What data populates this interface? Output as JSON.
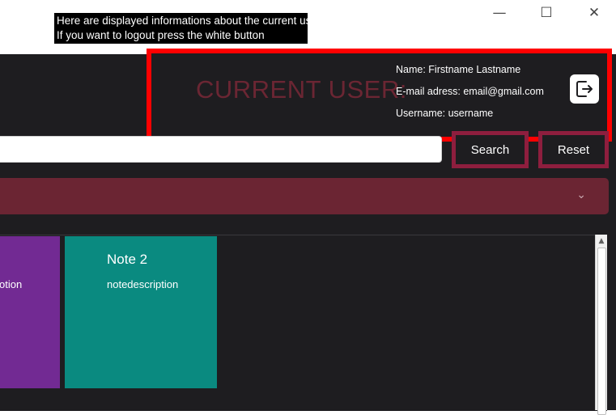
{
  "tooltip": {
    "line1": "Here are displayed informations about the current user",
    "line2": "If you want to logout press the white button"
  },
  "window_controls": {
    "minimize": "—",
    "maximize": "☐",
    "close": "✕"
  },
  "user_panel": {
    "title": "CURRENT USER:",
    "name": "Name: Firstname Lastname",
    "email": "E-mail adress: email@gmail.com",
    "username": "Username: username",
    "logout_icon": "logout-icon"
  },
  "search": {
    "value": "",
    "search_label": "Search",
    "reset_label": "Reset"
  },
  "dropdown": {
    "value": "",
    "chevron": "⌄"
  },
  "notes": [
    {
      "title": "",
      "description": "otion",
      "color": "#722a93"
    },
    {
      "title": "Note 2",
      "description": "notedescription",
      "color": "#0a8a80"
    }
  ],
  "scrollbar": {
    "up_arrow": "▲"
  },
  "colors": {
    "background": "#1e1d20",
    "accent": "#6b2533",
    "highlight_border": "#ff0000",
    "button_border": "#8e1e3e"
  }
}
